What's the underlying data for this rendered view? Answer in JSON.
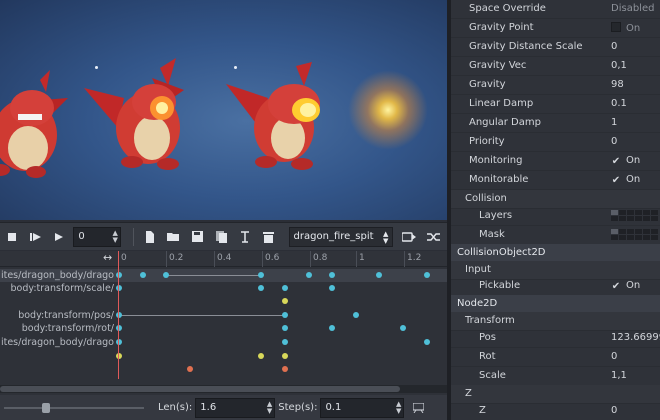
{
  "toolbar": {
    "frame_value": "0",
    "animation_name": "dragon_fire_spit"
  },
  "timeline": {
    "ruler_labels": [
      "0",
      "0.2",
      "0.4",
      "0.6",
      "0.8",
      "1",
      "1.2"
    ],
    "tracks": [
      {
        "name": "ites/dragon_body/drago"
      },
      {
        "name": "/body:transform/scale"
      },
      {
        "name": ""
      },
      {
        "name": "/body:transform/pos"
      },
      {
        "name": "/body:transform/rot"
      },
      {
        "name": "ites/dragon_body/drago"
      },
      {
        "name": ""
      },
      {
        "name": ""
      }
    ]
  },
  "bottom_bar": {
    "len_label": "Len(s):",
    "len_value": "1.6",
    "step_label": "Step(s):",
    "step_value": "0.1"
  },
  "inspector": {
    "space_override": {
      "label": "Space Override",
      "value": "Disabled"
    },
    "gravity_point": {
      "label": "Gravity Point",
      "value": "On"
    },
    "gravity_distance_scale": {
      "label": "Gravity Distance Scale",
      "value": "0"
    },
    "gravity_vec": {
      "label": "Gravity Vec",
      "value": "0,1"
    },
    "gravity": {
      "label": "Gravity",
      "value": "98"
    },
    "linear_damp": {
      "label": "Linear Damp",
      "value": "0.1"
    },
    "angular_damp": {
      "label": "Angular Damp",
      "value": "1"
    },
    "priority": {
      "label": "Priority",
      "value": "0"
    },
    "monitoring": {
      "label": "Monitoring",
      "value": "On"
    },
    "monitorable": {
      "label": "Monitorable",
      "value": "On"
    },
    "collision": {
      "label": "Collision"
    },
    "layers": {
      "label": "Layers"
    },
    "mask": {
      "label": "Mask"
    },
    "collision_object_2d": {
      "label": "CollisionObject2D"
    },
    "input": {
      "label": "Input"
    },
    "pickable": {
      "label": "Pickable",
      "value": "On"
    },
    "node_2d": {
      "label": "Node2D"
    },
    "transform": {
      "label": "Transform"
    },
    "pos": {
      "label": "Pos",
      "value": "123.66999!"
    },
    "rot": {
      "label": "Rot",
      "value": "0"
    },
    "scale": {
      "label": "Scale",
      "value": "1,1"
    },
    "z_section": {
      "label": "Z"
    },
    "z": {
      "label": "Z",
      "value": "0"
    }
  },
  "colors": {
    "key_blue": "#4fc0d8",
    "key_yellow": "#d8d85a",
    "key_orange": "#e07050",
    "playhead": "#e05a5a"
  }
}
